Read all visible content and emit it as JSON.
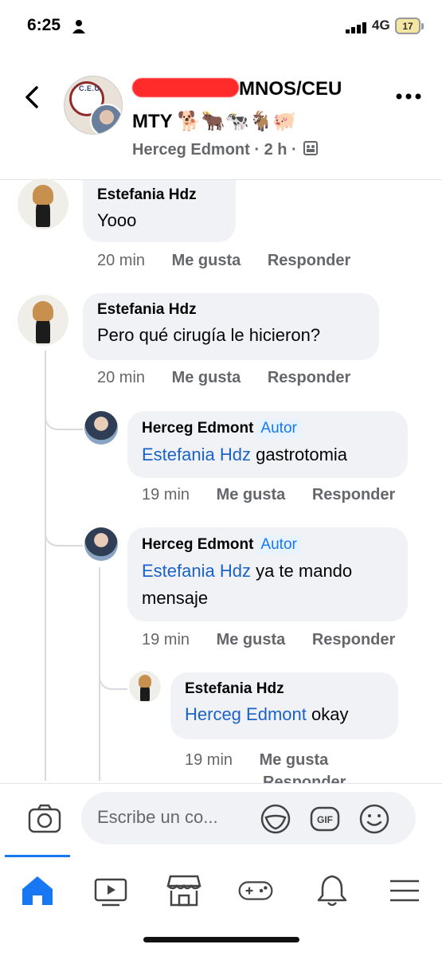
{
  "status_bar": {
    "time": "6:25",
    "network": "4G",
    "battery": "17"
  },
  "header": {
    "group_name_line1": "MNOS/CEU",
    "group_name_line2": "MTY 🐕🐂🐄🐐🐖",
    "author": "Herceg Edmont",
    "meta": "Herceg Edmont · 2 h ·",
    "seal_text": "C.E.U"
  },
  "comments": [
    {
      "author": "Estefania Hdz",
      "text": "Yooo",
      "time": "20 min",
      "like": "Me gusta",
      "reply": "Responder"
    },
    {
      "author": "Estefania Hdz",
      "text": "Pero qué cirugía le hicieron?",
      "time": "20 min",
      "like": "Me gusta",
      "reply": "Responder",
      "replies": [
        {
          "author": "Herceg Edmont",
          "badge": "Autor",
          "mention": "Estefania Hdz",
          "text": " gastrotomia",
          "time": "19 min",
          "like": "Me gusta",
          "reply": "Responder"
        },
        {
          "author": "Herceg Edmont",
          "badge": "Autor",
          "mention": "Estefania Hdz",
          "text": " ya te mando",
          "text2": "mensaje",
          "time": "19 min",
          "like": "Me gusta",
          "reply": "Responder"
        },
        {
          "author": "Estefania Hdz",
          "mention": "Herceg Edmont",
          "text": " okay",
          "time": "19 min",
          "like": "Me gusta",
          "reply": "Responder"
        }
      ]
    }
  ],
  "composer": {
    "placeholder": "Escribe un co...",
    "gif_label": "GIF"
  },
  "nav": {
    "items": [
      "home-icon",
      "video-icon",
      "marketplace-icon",
      "gaming-icon",
      "notifications-icon",
      "menu-icon"
    ],
    "accent": "#1877f2"
  }
}
